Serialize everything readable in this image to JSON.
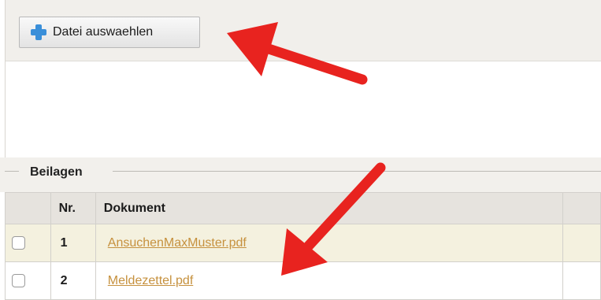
{
  "toolbar": {
    "choose_file_label": "Datei auswaehlen",
    "choose_file_icon": "plus-icon"
  },
  "attachments": {
    "section_title": "Beilagen",
    "columns": [
      "",
      "Nr.",
      "Dokument",
      ""
    ],
    "rows": [
      {
        "nr": "1",
        "document": "AnsuchenMaxMuster.pdf",
        "checked": false
      },
      {
        "nr": "2",
        "document": "Meldezettel.pdf",
        "checked": false
      }
    ]
  },
  "colors": {
    "arrow": "#e8231f",
    "link": "#c6913e",
    "row_highlight": "#f4f1df",
    "plus_icon": "#3a8fd9"
  }
}
